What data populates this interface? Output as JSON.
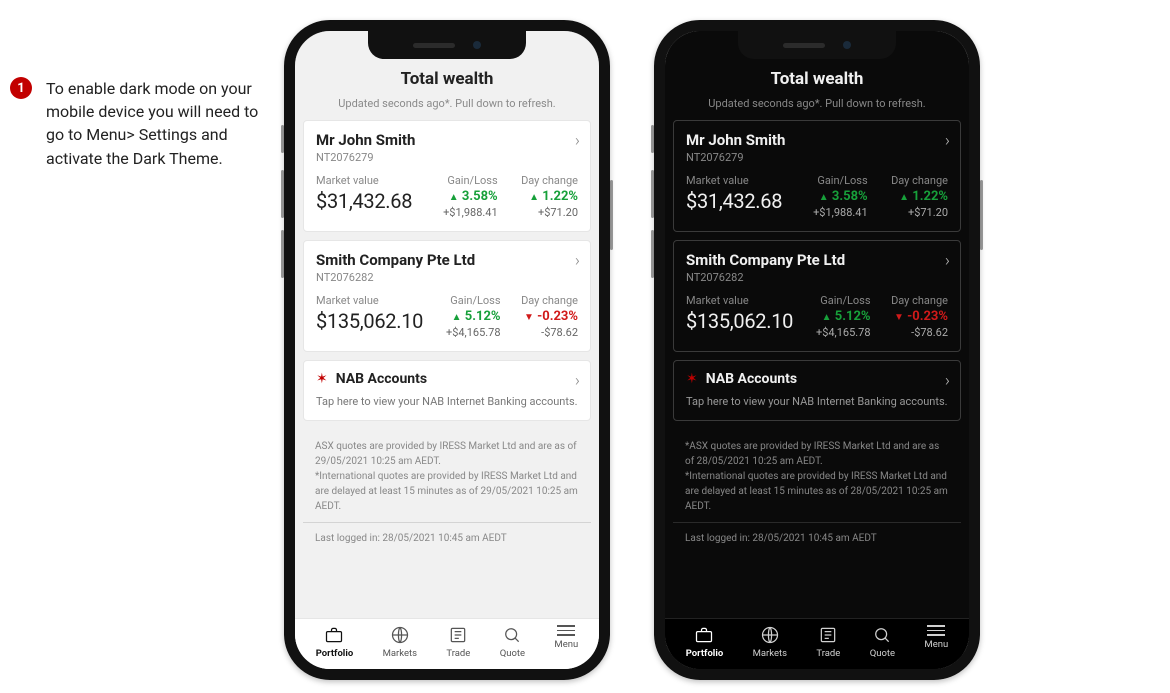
{
  "callout": {
    "number": "1",
    "text": "To enable dark mode on your mobile device you will need to go to Menu> Settings and activate the Dark Theme."
  },
  "header": {
    "title": "Total wealth",
    "subtitle": "Updated seconds ago*. Pull down to refresh."
  },
  "labels": {
    "market_value": "Market value",
    "gain_loss": "Gain/Loss",
    "day_change": "Day change"
  },
  "accounts": [
    {
      "name": "Mr John Smith",
      "number": "NT2076279",
      "market_value": "$31,432.68",
      "gainloss_pct": "3.58%",
      "gainloss_amt": "+$1,988.41",
      "gainloss_dir": "up",
      "daychange_pct": "1.22%",
      "daychange_amt": "+$71.20",
      "daychange_dir": "up"
    },
    {
      "name": "Smith Company Pte Ltd",
      "number": "NT2076282",
      "market_value": "$135,062.10",
      "gainloss_pct": "5.12%",
      "gainloss_amt": "+$4,165.78",
      "gainloss_dir": "up",
      "daychange_pct": "-0.23%",
      "daychange_amt": "-$78.62",
      "daychange_dir": "down"
    }
  ],
  "nab": {
    "title": "NAB Accounts",
    "subtitle": "Tap here to view your NAB Internet Banking accounts."
  },
  "disclaimer_light": "ASX quotes are provided by IRESS Market Ltd and are as of 29/05/2021 10:25 am AEDT.\n*International quotes are provided by IRESS Market Ltd and are delayed at least 15 minutes as of 29/05/2021 10:25 am AEDT.",
  "disclaimer_dark": "*ASX quotes are provided by IRESS Market Ltd and are as of 28/05/2021 10:25 am AEDT.\n*International quotes are provided by IRESS Market Ltd and are delayed at least 15 minutes as of 28/05/2021 10:25 am AEDT.",
  "last_login": "Last logged in: 28/05/2021 10:45 am AEDT",
  "tabs": [
    {
      "label": "Portfolio",
      "icon": "briefcase-icon",
      "active": true
    },
    {
      "label": "Markets",
      "icon": "globe-icon",
      "active": false
    },
    {
      "label": "Trade",
      "icon": "trade-icon",
      "active": false
    },
    {
      "label": "Quote",
      "icon": "search-icon",
      "active": false
    },
    {
      "label": "Menu",
      "icon": "menu-icon",
      "active": false
    }
  ]
}
